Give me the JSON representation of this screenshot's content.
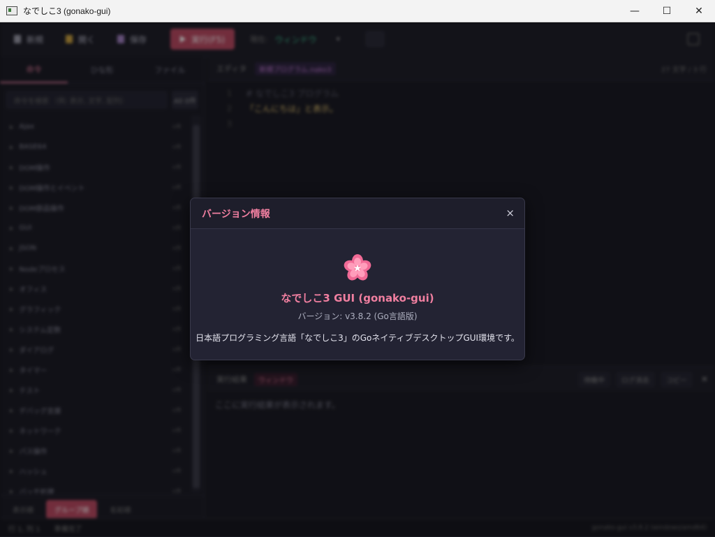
{
  "window": {
    "title": "なでしこ3 (gonako-gui)",
    "minimize": "—",
    "maximize": "☐",
    "close": "✕"
  },
  "toolbar": {
    "new_label": "新規",
    "open_label": "開く",
    "save_label": "保存",
    "run_label": "実行(F5)",
    "mode_label": "現在:",
    "mode_value": "ウィンドウ",
    "mode_caret": "▾"
  },
  "sidebar": {
    "tabs": [
      "命令",
      "ひな形",
      "ファイル"
    ],
    "search_placeholder": "命令を検索 （例: 表示, 文字, 配列）",
    "all_button": "All 0件",
    "categories": [
      {
        "name": "Ajax",
        "count": "n件"
      },
      {
        "name": "BASE64",
        "count": "n件"
      },
      {
        "name": "DOM操作",
        "count": "n件"
      },
      {
        "name": "DOM操作とイベント",
        "count": "n件"
      },
      {
        "name": "DOM部品操作",
        "count": "n件"
      },
      {
        "name": "GUI",
        "count": "n件"
      },
      {
        "name": "JSON",
        "count": "n件"
      },
      {
        "name": "Nodeプロセス",
        "count": "n件"
      },
      {
        "name": "オフィス",
        "count": "n件"
      },
      {
        "name": "グラフィック",
        "count": "n件"
      },
      {
        "name": "システム定数",
        "count": "n件"
      },
      {
        "name": "ダイアログ",
        "count": "n件"
      },
      {
        "name": "タイマー",
        "count": "n件"
      },
      {
        "name": "テスト",
        "count": "n件"
      },
      {
        "name": "デバッグ支援",
        "count": "n件"
      },
      {
        "name": "ネットワーク",
        "count": "n件"
      },
      {
        "name": "パス操作",
        "count": "n件"
      },
      {
        "name": "ハッシュ",
        "count": "n件"
      },
      {
        "name": "バッチ処理",
        "count": "n件"
      }
    ],
    "footer": [
      "表示順",
      "グループ順",
      "名前順"
    ]
  },
  "editor": {
    "label": "エディタ",
    "filename": "新規プログラム.nako3",
    "info": "27 文字 / 3 行",
    "lines": [
      "1",
      "2",
      "3"
    ],
    "code": [
      "# なでしこ3 プログラム",
      "「こんにちは」と表示。",
      ""
    ]
  },
  "output": {
    "label": "実行結果",
    "mode": "ウィンドウ",
    "buttons": [
      "待機中",
      "ログ消去",
      "コピー"
    ],
    "close": "✕",
    "placeholder": "ここに実行結果が表示されます。"
  },
  "statusbar": {
    "position": "行 1, 列 1",
    "status": "準備完了",
    "right": "gonako-gui v3.8.2 (windows/amd64)"
  },
  "dialog": {
    "title": "バージョン情報",
    "close": "×",
    "icon": "sakura-flower-icon",
    "app_name": "なでしこ3 GUI (gonako-gui)",
    "version": "バージョン: v3.8.2 (Go言語版)",
    "description": "日本語プログラミング言語「なでしこ3」のGoネイティブデスクトップGUI環境です。"
  },
  "colors": {
    "accent": "#f07fa0",
    "run_button": "#b84a62",
    "mode_green": "#3fbf8f",
    "dialog_bg": "#232333"
  }
}
